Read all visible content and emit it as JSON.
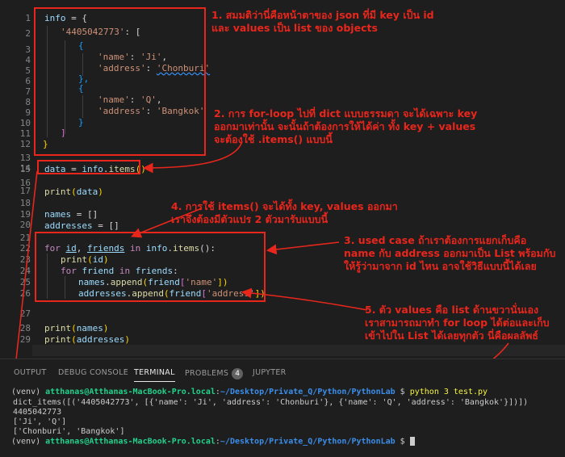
{
  "editor": {
    "line_numbers": [
      "1",
      "2",
      "3",
      "4",
      "5",
      "6",
      "7",
      "8",
      "9",
      "10",
      "11",
      "12",
      "13",
      "14",
      "15",
      "16",
      "17",
      "18",
      "19",
      "20",
      "21",
      "22",
      "23",
      "24",
      "25",
      "26",
      "27",
      "28",
      "29"
    ],
    "lines": {
      "l1": [
        "info",
        " = {"
      ],
      "l2": [
        "'4405042773'",
        ": ["
      ],
      "l3": "{",
      "l4": [
        "'name'",
        ": ",
        "'Ji'",
        ","
      ],
      "l5": [
        "'address'",
        ": ",
        "'Chonburi'"
      ],
      "l6": "},",
      "l7": "{",
      "l8": [
        "'name'",
        ": ",
        "'Q'",
        ","
      ],
      "l9": [
        "'address'",
        ": ",
        "'Bangkok'"
      ],
      "l10": "}",
      "l11": "]",
      "l12": "}",
      "l15": [
        "data",
        " = ",
        "info",
        ".",
        "items",
        "()"
      ],
      "l17": [
        "print",
        "(",
        "data",
        ")"
      ],
      "l19": [
        "names",
        " = []"
      ],
      "l20": [
        "addresses",
        " = []"
      ],
      "l22": [
        "for",
        " ",
        "id",
        ", ",
        "friends",
        " ",
        "in",
        " ",
        "info",
        ".",
        "items",
        "():"
      ],
      "l23": [
        "print",
        "(",
        "id",
        ")"
      ],
      "l24": [
        "for",
        " ",
        "friend",
        " ",
        "in",
        " ",
        "friends",
        ":"
      ],
      "l25": [
        "names",
        ".",
        "append",
        "(",
        "friend",
        "[",
        "'name'",
        "])"
      ],
      "l26": [
        "addresses",
        ".",
        "append",
        "(",
        "friend",
        "[",
        "'address'",
        "])"
      ],
      "l28": [
        "print",
        "(",
        "names",
        ")"
      ],
      "l29": [
        "print",
        "(",
        "addresses",
        ")"
      ]
    }
  },
  "annotations": {
    "a1": "1. สมมติว่านี่คือหน้าตาของ json ที่มี key เป็น id\nและ values เป็น list ของ objects",
    "a2": "2. การ for-loop ไปที่ dict แบบธรรมดา จะได้เฉพาะ key\nออกมาเท่านั้น จะนั้นถ้าต้องการให้ได้ค่า ทั้ง key + values\nจะต้องใช้ .items() แบบนี้",
    "a3": "3. used case ถ้าเราต้องการแยกเก็บคือ\nname กับ address ออกมาเป็น List พร้อมกับ\nให้รู้ว่ามาจาก id ไหน อาจใช้วิธีแบบนี้ได้เลย",
    "a4": "4. การใช้ items() จะได้ทั้ง key, values ออกมา\nเราจึงต้องมีตัวแปร 2 ตัวมารับแบบนี้",
    "a5": "5. ตัว values คือ list ด้านขวานั่นเอง\nเราสามารถมาทำ for loop ได้ต่อและเก็บ\nเข้าไปใน List ได้เลยทุกตัว นี่คือผลลัพธ์"
  },
  "panel": {
    "tabs": [
      "OUTPUT",
      "DEBUG CONSOLE",
      "TERMINAL",
      "PROBLEMS",
      "JUPYTER"
    ],
    "active_tab": "TERMINAL",
    "problems_count": "4"
  },
  "terminal": {
    "venv": "(venv) ",
    "host": "atthanas@Atthanas-MacBook-Pro.local",
    "sep": ":",
    "path": "~/Desktop/Private_Q/Python/PythonLab",
    "prompt": " $ ",
    "cmd": "python 3 test.py",
    "out1": "dict_items([('4405042773', [{'name': 'Ji', 'address': 'Chonburi'}, {'name': 'Q', 'address': 'Bangkok'}])])",
    "out2": "4405042773",
    "out3": "['Ji', 'Q']",
    "out4": "['Chonburi', 'Bangkok']"
  },
  "colors": {
    "annotation": "#e8261c",
    "background": "#1e1e1e"
  }
}
